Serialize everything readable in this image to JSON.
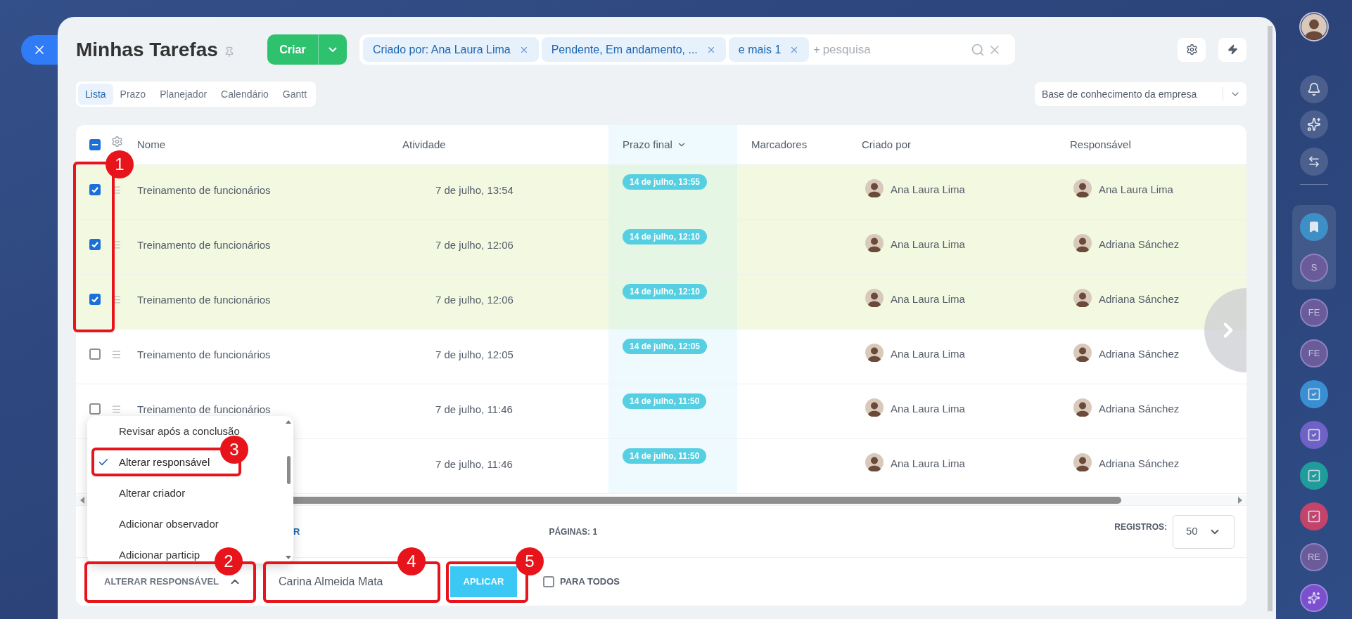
{
  "header": {
    "title": "Minhas Tarefas",
    "create_button": "Criar",
    "filters": [
      {
        "label": "Criado por: Ana Laura Lima"
      },
      {
        "label": "Pendente, Em andamento, ..."
      },
      {
        "label": "e mais 1"
      }
    ],
    "search": {
      "prefix": "+",
      "placeholder": "pesquisa"
    }
  },
  "view_tabs": [
    {
      "label": "Lista",
      "selected": true
    },
    {
      "label": "Prazo",
      "selected": false
    },
    {
      "label": "Planejador",
      "selected": false
    },
    {
      "label": "Calendário",
      "selected": false
    },
    {
      "label": "Gantt",
      "selected": false
    }
  ],
  "knowledge_base": {
    "label": "Base de conhecimento da empresa"
  },
  "table": {
    "select_all": {
      "indeterminate": true
    },
    "columns": [
      {
        "label": "Nome",
        "sorted": false
      },
      {
        "label": "Atividade",
        "sorted": false
      },
      {
        "label": "Prazo final",
        "sorted": true
      },
      {
        "label": "Marcadores",
        "sorted": false
      },
      {
        "label": "Criado por",
        "sorted": false
      },
      {
        "label": "Responsável",
        "sorted": false
      }
    ],
    "rows": [
      {
        "checked": true,
        "name": "Treinamento de funcionários",
        "activity": "7 de julho, 13:54",
        "deadline": "14 de julho, 13:55",
        "created_by": "Ana Laura Lima",
        "responsible": "Ana Laura Lima"
      },
      {
        "checked": true,
        "name": "Treinamento de funcionários",
        "activity": "7 de julho, 12:06",
        "deadline": "14 de julho, 12:10",
        "created_by": "Ana Laura Lima",
        "responsible": "Adriana Sánchez"
      },
      {
        "checked": true,
        "name": "Treinamento de funcionários",
        "activity": "7 de julho, 12:06",
        "deadline": "14 de julho, 12:10",
        "created_by": "Ana Laura Lima",
        "responsible": "Adriana Sánchez"
      },
      {
        "checked": false,
        "name": "Treinamento de funcionários",
        "activity": "7 de julho, 12:05",
        "deadline": "14 de julho, 12:05",
        "created_by": "Ana Laura Lima",
        "responsible": "Adriana Sánchez"
      },
      {
        "checked": false,
        "name": "Treinamento de funcionários",
        "activity": "7 de julho, 11:46",
        "deadline": "14 de julho, 11:50",
        "created_by": "Ana Laura Lima",
        "responsible": "Adriana Sánchez"
      },
      {
        "activity": "7 de julho, 11:46",
        "deadline": "14 de julho, 11:50",
        "created_by": "Ana Laura Lima",
        "responsible": "Adriana Sánchez"
      }
    ]
  },
  "footer": {
    "link_fragment": "R",
    "pages": "PÁGINAS: 1",
    "records_label": "REGISTROS:",
    "records_value": "50"
  },
  "action_menu": {
    "items": [
      {
        "label": "Revisar após a conclusão",
        "selected": false
      },
      {
        "label": "Alterar responsável",
        "selected": true
      },
      {
        "label": "Alterar criador",
        "selected": false
      },
      {
        "label": "Adicionar observador",
        "selected": false
      },
      {
        "label": "Adicionar particip",
        "selected": false
      }
    ]
  },
  "action_bar": {
    "action": "ALTERAR RESPONSÁVEL",
    "expanded": true,
    "value": "Carina Almeida Mata",
    "apply": "APLICAR",
    "for_all": {
      "label": "PARA TODOS",
      "checked": false
    }
  },
  "annotations": [
    {
      "number": "1"
    },
    {
      "number": "2"
    },
    {
      "number": "3"
    },
    {
      "number": "4"
    },
    {
      "number": "5"
    }
  ],
  "sidebar": {
    "top": [
      {
        "kind": "avatar"
      },
      {
        "kind": "bell"
      },
      {
        "kind": "sparkle"
      },
      {
        "kind": "swap"
      }
    ],
    "pinned": [
      {
        "kind": "bookmark"
      },
      {
        "kind": "initials",
        "label": "S"
      }
    ],
    "chats": [
      {
        "kind": "initials",
        "label": "FE"
      },
      {
        "kind": "initials",
        "label": "FE"
      },
      {
        "kind": "task",
        "color": "#3a8fd3"
      },
      {
        "kind": "task",
        "color": "#6f62c6"
      },
      {
        "kind": "task",
        "color": "#1f9c9c"
      },
      {
        "kind": "task",
        "color": "#c4436b"
      },
      {
        "kind": "initials",
        "label": "RE"
      },
      {
        "kind": "assistant"
      }
    ]
  }
}
